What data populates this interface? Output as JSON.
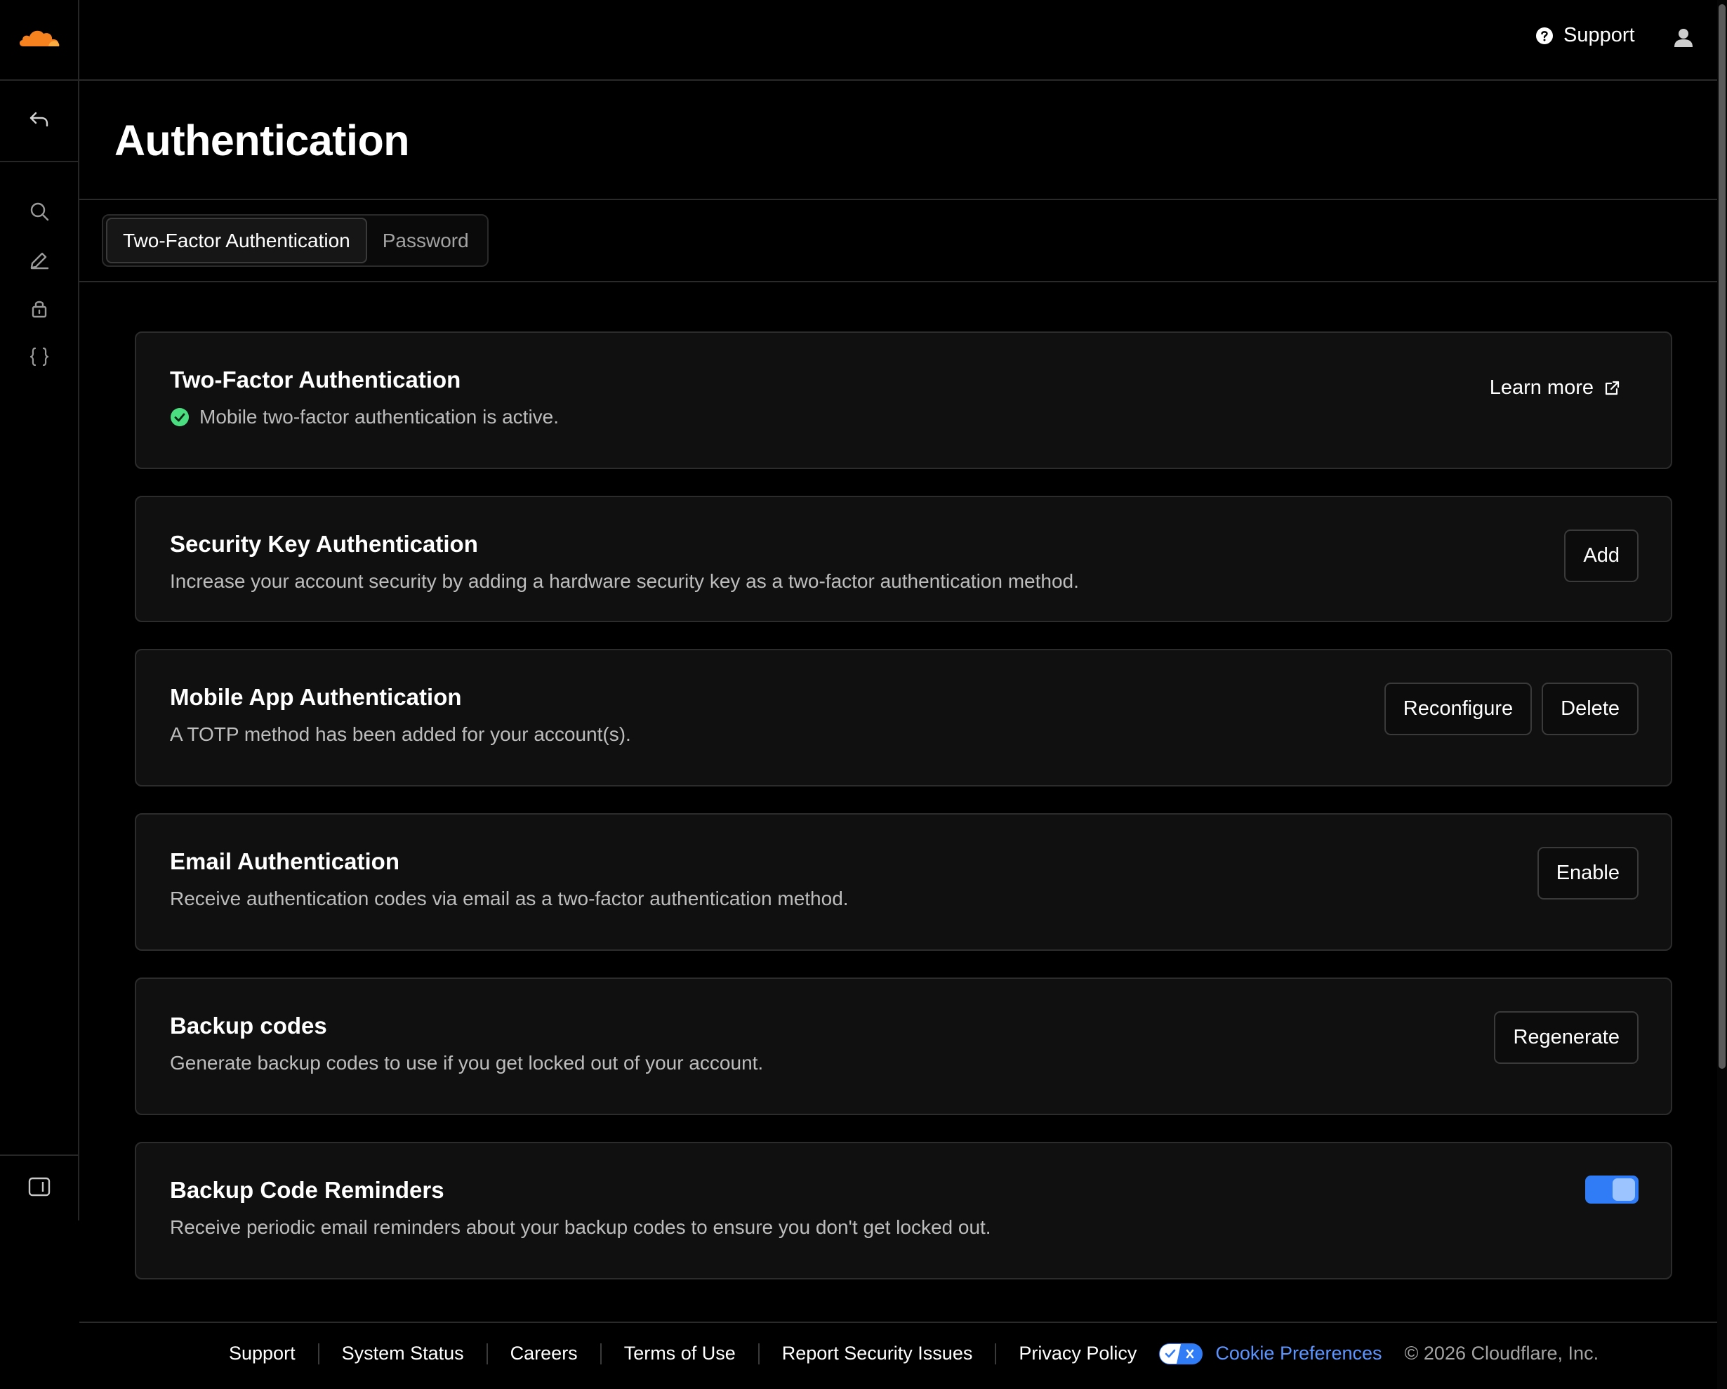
{
  "header": {
    "support_label": "Support"
  },
  "page": {
    "title": "Authentication"
  },
  "tabs": [
    {
      "label": "Two-Factor Authentication",
      "active": true
    },
    {
      "label": "Password",
      "active": false
    }
  ],
  "cards": {
    "two_factor": {
      "title": "Two-Factor Authentication",
      "status": "Mobile two-factor authentication is active.",
      "link_label": "Learn more"
    },
    "security_key": {
      "title": "Security Key Authentication",
      "description": "Increase your account security by adding a hardware security key as a two-factor authentication method.",
      "button_label": "Add"
    },
    "mobile_app": {
      "title": "Mobile App Authentication",
      "description": "A TOTP method has been added for your account(s).",
      "reconfigure_label": "Reconfigure",
      "delete_label": "Delete"
    },
    "email": {
      "title": "Email Authentication",
      "description": "Receive authentication codes via email as a two-factor authentication method.",
      "button_label": "Enable"
    },
    "backup_codes": {
      "title": "Backup codes",
      "description": "Generate backup codes to use if you get locked out of your account.",
      "button_label": "Regenerate"
    },
    "backup_reminders": {
      "title": "Backup Code Reminders",
      "description": "Receive periodic email reminders about your backup codes to ensure you don't get locked out.",
      "toggle_on": true
    }
  },
  "footer": {
    "links": [
      "Support",
      "System Status",
      "Careers",
      "Terms of Use",
      "Report Security Issues",
      "Privacy Policy"
    ],
    "cookie_label": "Cookie Preferences",
    "copyright": "© 2026 Cloudflare, Inc."
  },
  "colors": {
    "brand_orange": "#f6821f",
    "accent_blue": "#2f7cf6",
    "success_green": "#4ade80"
  },
  "icons": {
    "logo": "cloudflare-logo-icon",
    "back": "undo-arrow-icon",
    "nav": [
      "search-icon",
      "pencil-icon",
      "lock-icon",
      "braces-icon"
    ],
    "sidebar_toggle": "sidebar-panel-icon"
  }
}
